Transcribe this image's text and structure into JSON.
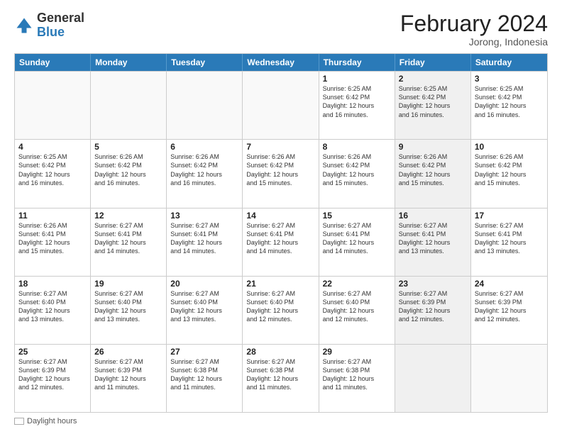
{
  "header": {
    "logo_general": "General",
    "logo_blue": "Blue",
    "month_title": "February 2024",
    "subtitle": "Jorong, Indonesia"
  },
  "days_of_week": [
    "Sunday",
    "Monday",
    "Tuesday",
    "Wednesday",
    "Thursday",
    "Friday",
    "Saturday"
  ],
  "weeks": [
    [
      {
        "day": "",
        "lines": [],
        "shaded": false
      },
      {
        "day": "",
        "lines": [],
        "shaded": false
      },
      {
        "day": "",
        "lines": [],
        "shaded": false
      },
      {
        "day": "",
        "lines": [],
        "shaded": false
      },
      {
        "day": "1",
        "lines": [
          "Sunrise: 6:25 AM",
          "Sunset: 6:42 PM",
          "Daylight: 12 hours",
          "and 16 minutes."
        ],
        "shaded": false
      },
      {
        "day": "2",
        "lines": [
          "Sunrise: 6:25 AM",
          "Sunset: 6:42 PM",
          "Daylight: 12 hours",
          "and 16 minutes."
        ],
        "shaded": true
      },
      {
        "day": "3",
        "lines": [
          "Sunrise: 6:25 AM",
          "Sunset: 6:42 PM",
          "Daylight: 12 hours",
          "and 16 minutes."
        ],
        "shaded": false
      }
    ],
    [
      {
        "day": "4",
        "lines": [
          "Sunrise: 6:25 AM",
          "Sunset: 6:42 PM",
          "Daylight: 12 hours",
          "and 16 minutes."
        ],
        "shaded": false
      },
      {
        "day": "5",
        "lines": [
          "Sunrise: 6:26 AM",
          "Sunset: 6:42 PM",
          "Daylight: 12 hours",
          "and 16 minutes."
        ],
        "shaded": false
      },
      {
        "day": "6",
        "lines": [
          "Sunrise: 6:26 AM",
          "Sunset: 6:42 PM",
          "Daylight: 12 hours",
          "and 16 minutes."
        ],
        "shaded": false
      },
      {
        "day": "7",
        "lines": [
          "Sunrise: 6:26 AM",
          "Sunset: 6:42 PM",
          "Daylight: 12 hours",
          "and 15 minutes."
        ],
        "shaded": false
      },
      {
        "day": "8",
        "lines": [
          "Sunrise: 6:26 AM",
          "Sunset: 6:42 PM",
          "Daylight: 12 hours",
          "and 15 minutes."
        ],
        "shaded": false
      },
      {
        "day": "9",
        "lines": [
          "Sunrise: 6:26 AM",
          "Sunset: 6:42 PM",
          "Daylight: 12 hours",
          "and 15 minutes."
        ],
        "shaded": true
      },
      {
        "day": "10",
        "lines": [
          "Sunrise: 6:26 AM",
          "Sunset: 6:42 PM",
          "Daylight: 12 hours",
          "and 15 minutes."
        ],
        "shaded": false
      }
    ],
    [
      {
        "day": "11",
        "lines": [
          "Sunrise: 6:26 AM",
          "Sunset: 6:41 PM",
          "Daylight: 12 hours",
          "and 15 minutes."
        ],
        "shaded": false
      },
      {
        "day": "12",
        "lines": [
          "Sunrise: 6:27 AM",
          "Sunset: 6:41 PM",
          "Daylight: 12 hours",
          "and 14 minutes."
        ],
        "shaded": false
      },
      {
        "day": "13",
        "lines": [
          "Sunrise: 6:27 AM",
          "Sunset: 6:41 PM",
          "Daylight: 12 hours",
          "and 14 minutes."
        ],
        "shaded": false
      },
      {
        "day": "14",
        "lines": [
          "Sunrise: 6:27 AM",
          "Sunset: 6:41 PM",
          "Daylight: 12 hours",
          "and 14 minutes."
        ],
        "shaded": false
      },
      {
        "day": "15",
        "lines": [
          "Sunrise: 6:27 AM",
          "Sunset: 6:41 PM",
          "Daylight: 12 hours",
          "and 14 minutes."
        ],
        "shaded": false
      },
      {
        "day": "16",
        "lines": [
          "Sunrise: 6:27 AM",
          "Sunset: 6:41 PM",
          "Daylight: 12 hours",
          "and 13 minutes."
        ],
        "shaded": true
      },
      {
        "day": "17",
        "lines": [
          "Sunrise: 6:27 AM",
          "Sunset: 6:41 PM",
          "Daylight: 12 hours",
          "and 13 minutes."
        ],
        "shaded": false
      }
    ],
    [
      {
        "day": "18",
        "lines": [
          "Sunrise: 6:27 AM",
          "Sunset: 6:40 PM",
          "Daylight: 12 hours",
          "and 13 minutes."
        ],
        "shaded": false
      },
      {
        "day": "19",
        "lines": [
          "Sunrise: 6:27 AM",
          "Sunset: 6:40 PM",
          "Daylight: 12 hours",
          "and 13 minutes."
        ],
        "shaded": false
      },
      {
        "day": "20",
        "lines": [
          "Sunrise: 6:27 AM",
          "Sunset: 6:40 PM",
          "Daylight: 12 hours",
          "and 13 minutes."
        ],
        "shaded": false
      },
      {
        "day": "21",
        "lines": [
          "Sunrise: 6:27 AM",
          "Sunset: 6:40 PM",
          "Daylight: 12 hours",
          "and 12 minutes."
        ],
        "shaded": false
      },
      {
        "day": "22",
        "lines": [
          "Sunrise: 6:27 AM",
          "Sunset: 6:40 PM",
          "Daylight: 12 hours",
          "and 12 minutes."
        ],
        "shaded": false
      },
      {
        "day": "23",
        "lines": [
          "Sunrise: 6:27 AM",
          "Sunset: 6:39 PM",
          "Daylight: 12 hours",
          "and 12 minutes."
        ],
        "shaded": true
      },
      {
        "day": "24",
        "lines": [
          "Sunrise: 6:27 AM",
          "Sunset: 6:39 PM",
          "Daylight: 12 hours",
          "and 12 minutes."
        ],
        "shaded": false
      }
    ],
    [
      {
        "day": "25",
        "lines": [
          "Sunrise: 6:27 AM",
          "Sunset: 6:39 PM",
          "Daylight: 12 hours",
          "and 12 minutes."
        ],
        "shaded": false
      },
      {
        "day": "26",
        "lines": [
          "Sunrise: 6:27 AM",
          "Sunset: 6:39 PM",
          "Daylight: 12 hours",
          "and 11 minutes."
        ],
        "shaded": false
      },
      {
        "day": "27",
        "lines": [
          "Sunrise: 6:27 AM",
          "Sunset: 6:38 PM",
          "Daylight: 12 hours",
          "and 11 minutes."
        ],
        "shaded": false
      },
      {
        "day": "28",
        "lines": [
          "Sunrise: 6:27 AM",
          "Sunset: 6:38 PM",
          "Daylight: 12 hours",
          "and 11 minutes."
        ],
        "shaded": false
      },
      {
        "day": "29",
        "lines": [
          "Sunrise: 6:27 AM",
          "Sunset: 6:38 PM",
          "Daylight: 12 hours",
          "and 11 minutes."
        ],
        "shaded": false
      },
      {
        "day": "",
        "lines": [],
        "shaded": true
      },
      {
        "day": "",
        "lines": [],
        "shaded": false
      }
    ]
  ],
  "footer": {
    "daylight_label": "Daylight hours"
  }
}
